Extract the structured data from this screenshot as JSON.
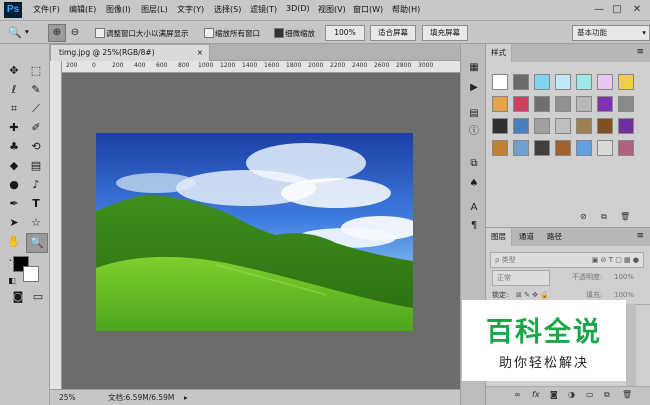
{
  "app": {
    "logo": "Ps",
    "window_controls": [
      "—",
      "□",
      "✕"
    ]
  },
  "menu": [
    "文件(F)",
    "编辑(E)",
    "图像(I)",
    "图层(L)",
    "文字(Y)",
    "选择(S)",
    "滤镜(T)",
    "3D(D)",
    "视图(V)",
    "窗口(W)",
    "帮助(H)"
  ],
  "options": {
    "tool_icon": "zoom-icon",
    "check_resize_window": "调整窗口大小以满屏显示",
    "check_zoom_all": "缩放所有窗口",
    "check_scrubby": "细微缩放",
    "zoom_value": "100%",
    "btn_fit": "适合屏幕",
    "btn_fill": "填充屏幕",
    "workspace": "基本功能"
  },
  "document": {
    "tab_title": "timg.jpg @ 25%(RGB/8#)",
    "ruler_ticks": [
      "200",
      "0",
      "200",
      "400",
      "600",
      "800",
      "1000",
      "1200",
      "1400",
      "1600",
      "1800",
      "2000",
      "2200",
      "2400",
      "2600",
      "2800",
      "3000"
    ],
    "status_zoom": "25%",
    "status_doc": "文档:6.59M/6.59M"
  },
  "styles_panel": {
    "tab": "样式"
  },
  "layers_panel": {
    "tabs": [
      "图层",
      "通道",
      "路径"
    ],
    "filter_label": "ρ 类型",
    "blend_mode": "正常",
    "opacity_label": "不透明度:",
    "opacity_value": "100%",
    "lock_label": "锁定:",
    "fill_label": "填充:",
    "fill_value": "100%"
  },
  "watermark": {
    "title": "百科全说",
    "subtitle": "助你轻松解决"
  },
  "colors": {
    "accent": "#1ba64a",
    "ps_blue": "#31a8ff",
    "canvas_bg": "#6c6c6c"
  }
}
